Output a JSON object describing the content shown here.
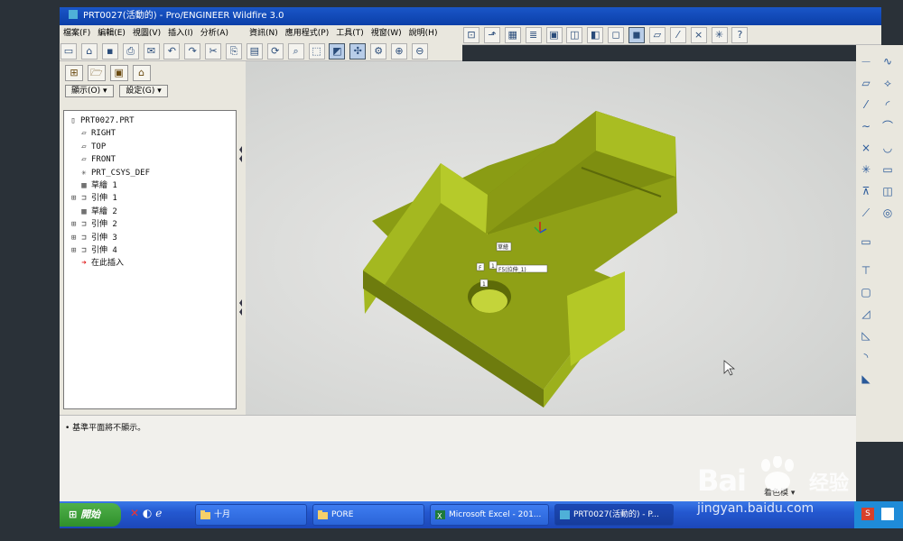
{
  "window": {
    "title": "PRT0027(活動的) - Pro/ENGINEER Wildfire 3.0"
  },
  "menu": [
    {
      "label": "檔案(F)"
    },
    {
      "label": "編輯(E)"
    },
    {
      "label": "視圖(V)"
    },
    {
      "label": "插入(I)"
    },
    {
      "label": "分析(A)"
    },
    {
      "label": "資訊(N)"
    },
    {
      "label": "應用程式(P)"
    },
    {
      "label": "工具(T)"
    },
    {
      "label": "視窗(W)"
    },
    {
      "label": "說明(H)"
    }
  ],
  "toolbar_icons": [
    "new-icon",
    "open-icon",
    "save-icon",
    "print-icon",
    "email-icon",
    "copy-icon",
    "undo-icon",
    "redo-icon",
    "cut-icon",
    "paste-icon",
    "regenerate-icon",
    "find-icon",
    "select-icon",
    "dropdown-icon"
  ],
  "view_toolbar_icons": [
    "redraw-icon",
    "spin-center-icon",
    "orientation-icon",
    "zoom-in-icon",
    "zoom-out-icon",
    "refit-icon",
    "reorient-icon",
    "saved-views-icon",
    "layers-icon",
    "view-manager-icon",
    "wireframe-icon",
    "hidden-line-icon",
    "no-hidden-icon",
    "shading-icon",
    "datum-planes-icon",
    "datum-axes-icon",
    "datum-points-icon",
    "coord-systems-icon",
    "context-help-icon"
  ],
  "panel": {
    "tabs": [
      "model-tree-tab",
      "folder-browser-tab",
      "favorites-tab",
      "connections-tab"
    ],
    "show_button": "顯示(O)",
    "settings_button": "設定(G)"
  },
  "model_tree": [
    {
      "label": "PRT0027.PRT",
      "icon": "part-icon",
      "expandable": false
    },
    {
      "label": "RIGHT",
      "icon": "datum-plane-icon",
      "expandable": false
    },
    {
      "label": "TOP",
      "icon": "datum-plane-icon",
      "expandable": false
    },
    {
      "label": "FRONT",
      "icon": "datum-plane-icon",
      "expandable": false
    },
    {
      "label": "PRT_CSYS_DEF",
      "icon": "csys-icon",
      "expandable": false
    },
    {
      "label": "草繪 1",
      "icon": "sketch-icon",
      "expandable": false
    },
    {
      "label": "引伸 1",
      "icon": "extrude-icon",
      "expandable": true
    },
    {
      "label": "草繪 2",
      "icon": "sketch-icon",
      "expandable": false
    },
    {
      "label": "引伸 2",
      "icon": "extrude-icon",
      "expandable": true
    },
    {
      "label": "引伸 3",
      "icon": "extrude-icon",
      "expandable": true
    },
    {
      "label": "引伸 4",
      "icon": "extrude-icon",
      "expandable": true
    },
    {
      "label": "在此插入",
      "icon": "insert-here-icon",
      "expandable": false
    }
  ],
  "message": "• 基準平面將不顯示。",
  "status_right": "着色模",
  "taskbar": {
    "start": "開始",
    "items": [
      {
        "label": "十月",
        "icon": "folder-icon"
      },
      {
        "label": "PORE",
        "icon": "folder-icon"
      },
      {
        "label": "Microsoft Excel - 201...",
        "icon": "excel-icon"
      },
      {
        "label": "PRT0027(活動的) - P...",
        "icon": "proe-icon"
      }
    ]
  },
  "model_labels": [
    "草繪",
    "F",
    "1",
    "F5(拉伸_1)",
    "1"
  ],
  "watermark": {
    "brand": "Bai",
    "cn": "经验",
    "url": "jingyan.baidu.com"
  },
  "colors": {
    "solid": "#9aac1c",
    "solid_dark": "#6f7c10",
    "titlebar": "#0b3fa8",
    "taskbar": "#2458d0"
  }
}
